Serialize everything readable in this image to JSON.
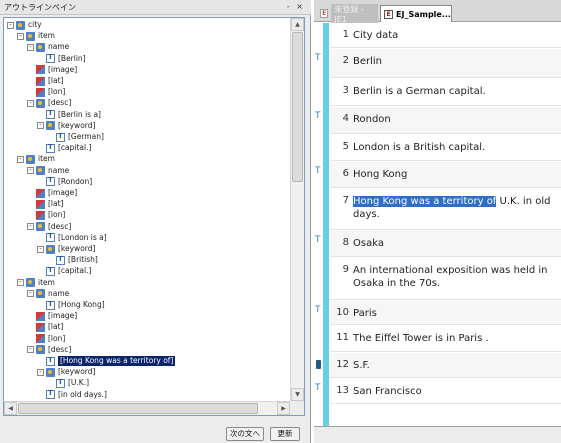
{
  "left_panel": {
    "title": "アウトラインペイン",
    "pin_close": "- ×",
    "tree": [
      {
        "depth": 0,
        "toggle": "-",
        "icon": "element",
        "label": "city"
      },
      {
        "depth": 1,
        "toggle": "-",
        "icon": "element",
        "label": "item"
      },
      {
        "depth": 2,
        "toggle": "-",
        "icon": "element",
        "label": "name"
      },
      {
        "depth": 3,
        "toggle": "",
        "icon": "text",
        "label": "[Berlin]"
      },
      {
        "depth": 2,
        "toggle": "",
        "icon": "attribute",
        "label": "[image]"
      },
      {
        "depth": 2,
        "toggle": "",
        "icon": "attribute",
        "label": "[lat]"
      },
      {
        "depth": 2,
        "toggle": "",
        "icon": "attribute",
        "label": "[lon]"
      },
      {
        "depth": 2,
        "toggle": "-",
        "icon": "element",
        "label": "[desc]"
      },
      {
        "depth": 3,
        "toggle": "",
        "icon": "text",
        "label": "[Berlin is a]"
      },
      {
        "depth": 3,
        "toggle": "-",
        "icon": "element",
        "label": "[keyword]"
      },
      {
        "depth": 4,
        "toggle": "",
        "icon": "text",
        "label": "[German]"
      },
      {
        "depth": 3,
        "toggle": "",
        "icon": "text",
        "label": "[capital.]"
      },
      {
        "depth": 1,
        "toggle": "-",
        "icon": "element",
        "label": "item"
      },
      {
        "depth": 2,
        "toggle": "-",
        "icon": "element",
        "label": "name"
      },
      {
        "depth": 3,
        "toggle": "",
        "icon": "text",
        "label": "[Rondon]"
      },
      {
        "depth": 2,
        "toggle": "",
        "icon": "attribute",
        "label": "[image]"
      },
      {
        "depth": 2,
        "toggle": "",
        "icon": "attribute",
        "label": "[lat]"
      },
      {
        "depth": 2,
        "toggle": "",
        "icon": "attribute",
        "label": "[lon]"
      },
      {
        "depth": 2,
        "toggle": "-",
        "icon": "element",
        "label": "[desc]"
      },
      {
        "depth": 3,
        "toggle": "",
        "icon": "text",
        "label": "[London is a]"
      },
      {
        "depth": 3,
        "toggle": "-",
        "icon": "element",
        "label": "[keyword]"
      },
      {
        "depth": 4,
        "toggle": "",
        "icon": "text",
        "label": "[British]"
      },
      {
        "depth": 3,
        "toggle": "",
        "icon": "text",
        "label": "[capital.]"
      },
      {
        "depth": 1,
        "toggle": "-",
        "icon": "element",
        "label": "item"
      },
      {
        "depth": 2,
        "toggle": "-",
        "icon": "element",
        "label": "name"
      },
      {
        "depth": 3,
        "toggle": "",
        "icon": "text",
        "label": "[Hong Kong]"
      },
      {
        "depth": 2,
        "toggle": "",
        "icon": "attribute",
        "label": "[image]"
      },
      {
        "depth": 2,
        "toggle": "",
        "icon": "attribute",
        "label": "[lat]"
      },
      {
        "depth": 2,
        "toggle": "",
        "icon": "attribute",
        "label": "[lon]"
      },
      {
        "depth": 2,
        "toggle": "-",
        "icon": "element",
        "label": "[desc]"
      },
      {
        "depth": 3,
        "toggle": "",
        "icon": "text",
        "label": "[Hong Kong was a territory of]",
        "selected": true
      },
      {
        "depth": 3,
        "toggle": "-",
        "icon": "element",
        "label": "[keyword]"
      },
      {
        "depth": 4,
        "toggle": "",
        "icon": "text",
        "label": "[U.K.]"
      },
      {
        "depth": 3,
        "toggle": "",
        "icon": "text",
        "label": "[in old days.]"
      }
    ],
    "buttons": {
      "next": "次の文へ",
      "update": "更新"
    }
  },
  "right_panel": {
    "tabs": [
      {
        "label": "未登録 - JE1",
        "active": false
      },
      {
        "label": "EJ_Sample...",
        "active": true
      }
    ],
    "lines": [
      {
        "num": "1",
        "text": "City data",
        "marker": ""
      },
      {
        "num": "2",
        "text": "Berlin",
        "marker": "T"
      },
      {
        "num": "3",
        "text": "Berlin is a German capital.",
        "marker": ""
      },
      {
        "num": "4",
        "text": "Rondon",
        "marker": "T"
      },
      {
        "num": "5",
        "text": "London is a British capital.",
        "marker": ""
      },
      {
        "num": "6",
        "text": "Hong Kong",
        "marker": "T"
      },
      {
        "num": "7",
        "text_highlight": "Hong Kong was a territory of",
        "text_rest": " U.K. in old days.",
        "marker": ""
      },
      {
        "num": "8",
        "text": "Osaka",
        "marker": "T"
      },
      {
        "num": "9",
        "text": "An international exposition was held in Osaka in the 70s.",
        "marker": ""
      },
      {
        "num": "10",
        "text": "Paris",
        "marker": "T"
      },
      {
        "num": "11",
        "text": "The Eiffel Tower is in Paris .",
        "marker": ""
      },
      {
        "num": "12",
        "text": "S.F.",
        "marker": "doc"
      },
      {
        "num": "13",
        "text": "San Francisco",
        "marker": "T"
      }
    ]
  },
  "colors": {
    "marker_strip": "#66cfe6",
    "selection": "#0a246a",
    "highlight": "#2f6ec8"
  }
}
